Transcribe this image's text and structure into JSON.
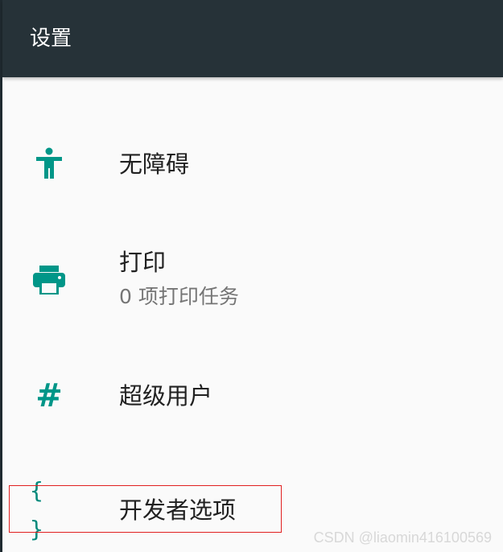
{
  "toolbar": {
    "title": "设置"
  },
  "items": [
    {
      "title": "无障碍",
      "icon": "accessibility-icon"
    },
    {
      "title": "打印",
      "summary": "0 项打印任务",
      "icon": "print-icon"
    },
    {
      "title": "超级用户",
      "icon": "hash-icon",
      "icon_glyph": "#"
    },
    {
      "title": "开发者选项",
      "icon": "developer-options-icon",
      "icon_glyph": "{ }"
    }
  ],
  "watermark": "CSDN @liaomin416100569",
  "colors": {
    "toolbar_bg": "#263238",
    "accent": "#009688",
    "highlight_border": "#e02020",
    "page_bg": "#fafafa"
  }
}
